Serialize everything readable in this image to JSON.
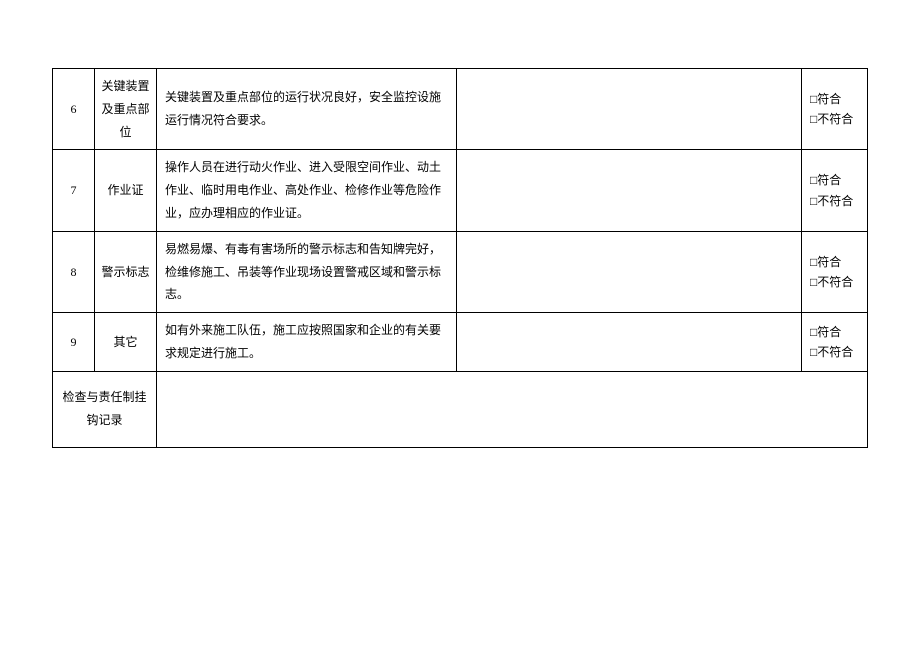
{
  "checkbox_glyph": "□",
  "status": {
    "conform": "符合",
    "nonconform": "不符合"
  },
  "rows": [
    {
      "num": "6",
      "category": "关键装置及重点部位",
      "description": "关键装置及重点部位的运行状况良好，安全监控设施运行情况符合要求。"
    },
    {
      "num": "7",
      "category": "作业证",
      "description": "操作人员在进行动火作业、进入受限空间作业、动土作业、临时用电作业、高处作业、检修作业等危险作业，应办理相应的作业证。"
    },
    {
      "num": "8",
      "category": "警示标志",
      "description": "易燃易爆、有毒有害场所的警示标志和告知牌完好，检维修施工、吊装等作业现场设置警戒区域和警示标志。"
    },
    {
      "num": "9",
      "category": "其它",
      "description": "如有外来施工队伍，施工应按照国家和企业的有关要求规定进行施工。"
    }
  ],
  "footer_label": "检查与责任制挂钩记录"
}
